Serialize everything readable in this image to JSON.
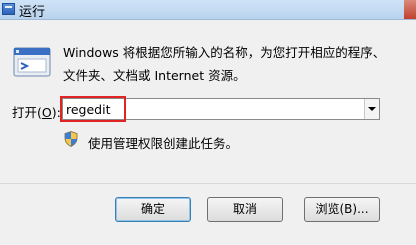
{
  "window": {
    "title": "运行",
    "icon": "run-icon",
    "close_button_color": "#c0402d"
  },
  "description": {
    "line1": "Windows 将根据您所输入的名称，为您打开相应的程序、",
    "line2": "文件夹、文档或 Internet 资源。"
  },
  "open_field": {
    "label": "打开",
    "mnemonic": "O",
    "label_open_paren": "(",
    "label_close": "):",
    "value": "regedit",
    "highlight_color": "#e02424"
  },
  "admin_note": {
    "icon": "uac-shield-icon",
    "text": "使用管理权限创建此任务。"
  },
  "buttons": {
    "ok": "确定",
    "cancel": "取消",
    "browse": "浏览(B)..."
  }
}
